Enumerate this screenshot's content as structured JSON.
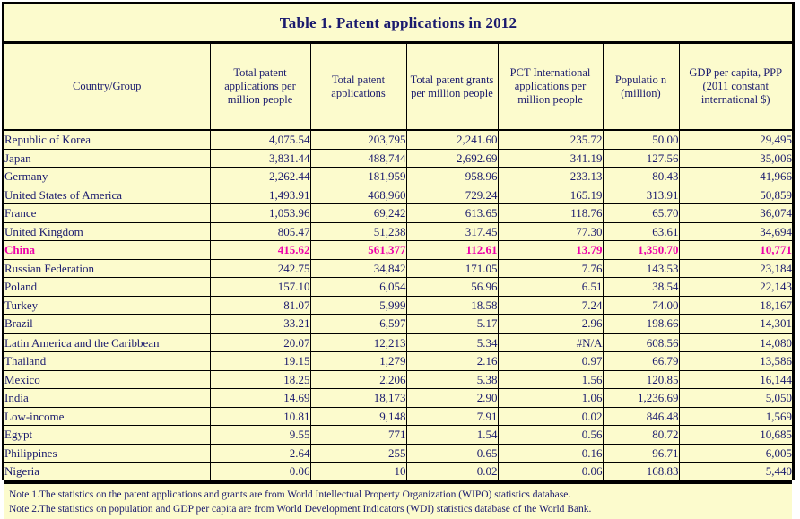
{
  "title": "Table 1. Patent applications in 2012",
  "table": {
    "columns": [
      "Country/Group",
      "Total patent applications per million people",
      "Total patent applications",
      "Total patent grants per million people",
      "PCT International applications per million people",
      "Populatio n (million)",
      "GDP per capita, PPP (2011 constant international $)"
    ],
    "rows": [
      {
        "country": "Republic of Korea",
        "apps_per_million": "4,075.54",
        "total_apps": "203,795",
        "grants_per_million": "2,241.60",
        "pct_per_million": "235.72",
        "population": "50.00",
        "gdp_per_capita": "29,495",
        "highlight": false,
        "group_start": false
      },
      {
        "country": "Japan",
        "apps_per_million": "3,831.44",
        "total_apps": "488,744",
        "grants_per_million": "2,692.69",
        "pct_per_million": "341.19",
        "population": "127.56",
        "gdp_per_capita": "35,006",
        "highlight": false,
        "group_start": false
      },
      {
        "country": "Germany",
        "apps_per_million": "2,262.44",
        "total_apps": "181,959",
        "grants_per_million": "958.96",
        "pct_per_million": "233.13",
        "population": "80.43",
        "gdp_per_capita": "41,966",
        "highlight": false,
        "group_start": false
      },
      {
        "country": "United States of America",
        "apps_per_million": "1,493.91",
        "total_apps": "468,960",
        "grants_per_million": "729.24",
        "pct_per_million": "165.19",
        "population": "313.91",
        "gdp_per_capita": "50,859",
        "highlight": false,
        "group_start": false
      },
      {
        "country": "France",
        "apps_per_million": "1,053.96",
        "total_apps": "69,242",
        "grants_per_million": "613.65",
        "pct_per_million": "118.76",
        "population": "65.70",
        "gdp_per_capita": "36,074",
        "highlight": false,
        "group_start": false
      },
      {
        "country": "United Kingdom",
        "apps_per_million": "805.47",
        "total_apps": "51,238",
        "grants_per_million": "317.45",
        "pct_per_million": "77.30",
        "population": "63.61",
        "gdp_per_capita": "34,694",
        "highlight": false,
        "group_start": false
      },
      {
        "country": "China",
        "apps_per_million": "415.62",
        "total_apps": "561,377",
        "grants_per_million": "112.61",
        "pct_per_million": "13.79",
        "population": "1,350.70",
        "gdp_per_capita": "10,771",
        "highlight": true,
        "group_start": false
      },
      {
        "country": "Russian Federation",
        "apps_per_million": "242.75",
        "total_apps": "34,842",
        "grants_per_million": "171.05",
        "pct_per_million": "7.76",
        "population": "143.53",
        "gdp_per_capita": "23,184",
        "highlight": false,
        "group_start": false
      },
      {
        "country": "Poland",
        "apps_per_million": "157.10",
        "total_apps": "6,054",
        "grants_per_million": "56.96",
        "pct_per_million": "6.51",
        "population": "38.54",
        "gdp_per_capita": "22,143",
        "highlight": false,
        "group_start": false
      },
      {
        "country": "Turkey",
        "apps_per_million": "81.07",
        "total_apps": "5,999",
        "grants_per_million": "18.58",
        "pct_per_million": "7.24",
        "population": "74.00",
        "gdp_per_capita": "18,167",
        "highlight": false,
        "group_start": false
      },
      {
        "country": "Brazil",
        "apps_per_million": "33.21",
        "total_apps": "6,597",
        "grants_per_million": "5.17",
        "pct_per_million": "2.96",
        "population": "198.66",
        "gdp_per_capita": "14,301",
        "highlight": false,
        "group_start": false
      },
      {
        "country": "Latin America and the Caribbean",
        "apps_per_million": "20.07",
        "total_apps": "12,213",
        "grants_per_million": "5.34",
        "pct_per_million": "#N/A",
        "population": "608.56",
        "gdp_per_capita": "14,080",
        "highlight": false,
        "group_start": true
      },
      {
        "country": "Thailand",
        "apps_per_million": "19.15",
        "total_apps": "1,279",
        "grants_per_million": "2.16",
        "pct_per_million": "0.97",
        "population": "66.79",
        "gdp_per_capita": "13,586",
        "highlight": false,
        "group_start": false
      },
      {
        "country": "Mexico",
        "apps_per_million": "18.25",
        "total_apps": "2,206",
        "grants_per_million": "5.38",
        "pct_per_million": "1.56",
        "population": "120.85",
        "gdp_per_capita": "16,144",
        "highlight": false,
        "group_start": false
      },
      {
        "country": "India",
        "apps_per_million": "14.69",
        "total_apps": "18,173",
        "grants_per_million": "2.90",
        "pct_per_million": "1.06",
        "population": "1,236.69",
        "gdp_per_capita": "5,050",
        "highlight": false,
        "group_start": false
      },
      {
        "country": "Low-income",
        "apps_per_million": "10.81",
        "total_apps": "9,148",
        "grants_per_million": "7.91",
        "pct_per_million": "0.02",
        "population": "846.48",
        "gdp_per_capita": "1,569",
        "highlight": false,
        "group_start": false
      },
      {
        "country": "Egypt",
        "apps_per_million": "9.55",
        "total_apps": "771",
        "grants_per_million": "1.54",
        "pct_per_million": "0.56",
        "population": "80.72",
        "gdp_per_capita": "10,685",
        "highlight": false,
        "group_start": false
      },
      {
        "country": "Philippines",
        "apps_per_million": "2.64",
        "total_apps": "255",
        "grants_per_million": "0.65",
        "pct_per_million": "0.16",
        "population": "96.71",
        "gdp_per_capita": "6,005",
        "highlight": false,
        "group_start": false
      },
      {
        "country": "Nigeria",
        "apps_per_million": "0.06",
        "total_apps": "10",
        "grants_per_million": "0.02",
        "pct_per_million": "0.06",
        "population": "168.83",
        "gdp_per_capita": "5,440",
        "highlight": false,
        "group_start": false
      }
    ]
  },
  "notes": [
    "Note 1.The statistics on the patent applications and grants are from World Intellectual Property Organization (WIPO) statistics database.",
    "Note 2.The statistics on population and GDP per capita are from World Development Indicators (WDI) statistics database of the World Bank."
  ],
  "colors": {
    "background": "#fcfbcd",
    "text": "#1a1a6e",
    "highlight": "#ee00aa",
    "border": "#000000"
  }
}
